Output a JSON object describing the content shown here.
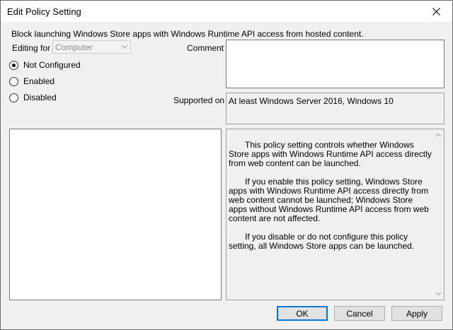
{
  "window": {
    "title": "Edit Policy Setting"
  },
  "policy": {
    "name": "Block launching Windows Store apps with Windows Runtime API access from hosted content."
  },
  "editing_for": {
    "label": "Editing for",
    "value": "Computer"
  },
  "state": {
    "options": [
      {
        "label": "Not Configured",
        "selected": true
      },
      {
        "label": "Enabled",
        "selected": false
      },
      {
        "label": "Disabled",
        "selected": false
      }
    ]
  },
  "comment": {
    "label": "Comment",
    "value": ""
  },
  "supported": {
    "label": "Supported on",
    "value": "At least Windows Server 2016, Windows 10"
  },
  "help": {
    "paragraphs": [
      "This policy setting controls whether Windows Store apps with Windows Runtime API access directly from web content can be launched.",
      "If you enable this policy setting, Windows Store apps with Windows Runtime API access directly from web content cannot be launched; Windows Store apps without Windows Runtime API access from web content are not affected.",
      "If you disable or do not configure this policy setting, all Windows Store apps can be launched."
    ]
  },
  "buttons": {
    "ok": "OK",
    "cancel": "Cancel",
    "apply": "Apply"
  }
}
